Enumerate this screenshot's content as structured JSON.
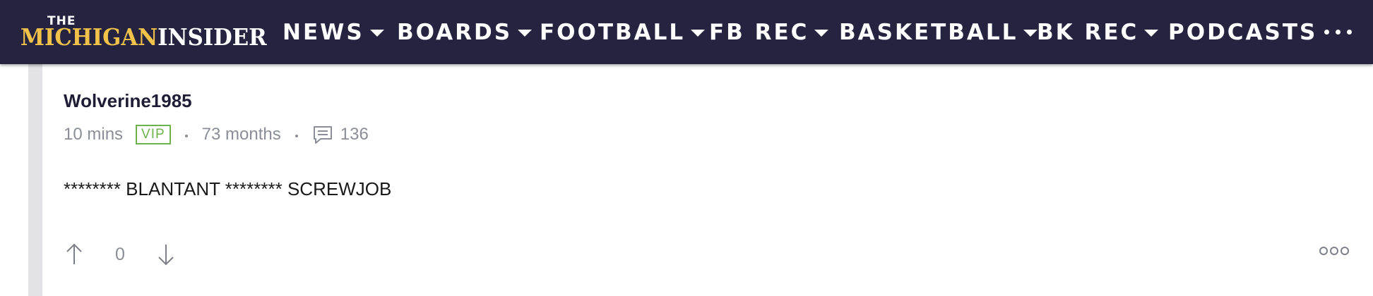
{
  "site": {
    "logo_the": "THE",
    "logo_michigan": "MICHIGAN",
    "logo_insider": "INSIDER",
    "brand_color": "#262341",
    "logo_accent": "#f0c24a"
  },
  "nav": {
    "items": [
      {
        "label": "NEWS",
        "dropdown": true
      },
      {
        "label": "BOARDS",
        "dropdown": true
      },
      {
        "label": "FOOTBALL",
        "dropdown": true
      },
      {
        "label": "FB REC",
        "dropdown": true
      },
      {
        "label": "BASKETBALL",
        "dropdown": true
      },
      {
        "label": "BK REC",
        "dropdown": true
      },
      {
        "label": "PODCASTS",
        "dropdown": false
      }
    ],
    "more_icon": "ellipsis-icon"
  },
  "post": {
    "author": "Wolverine1985",
    "time_ago": "10 mins",
    "badge": "VIP",
    "badge_color": "#6bb34a",
    "membership": "73 months",
    "post_count": "136",
    "body": "******** BLANTANT ******** SCREWJOB",
    "vote_count": "0",
    "upvote_icon": "arrow-up-icon",
    "downvote_icon": "arrow-down-icon",
    "options_icon": "more-options-icon"
  }
}
